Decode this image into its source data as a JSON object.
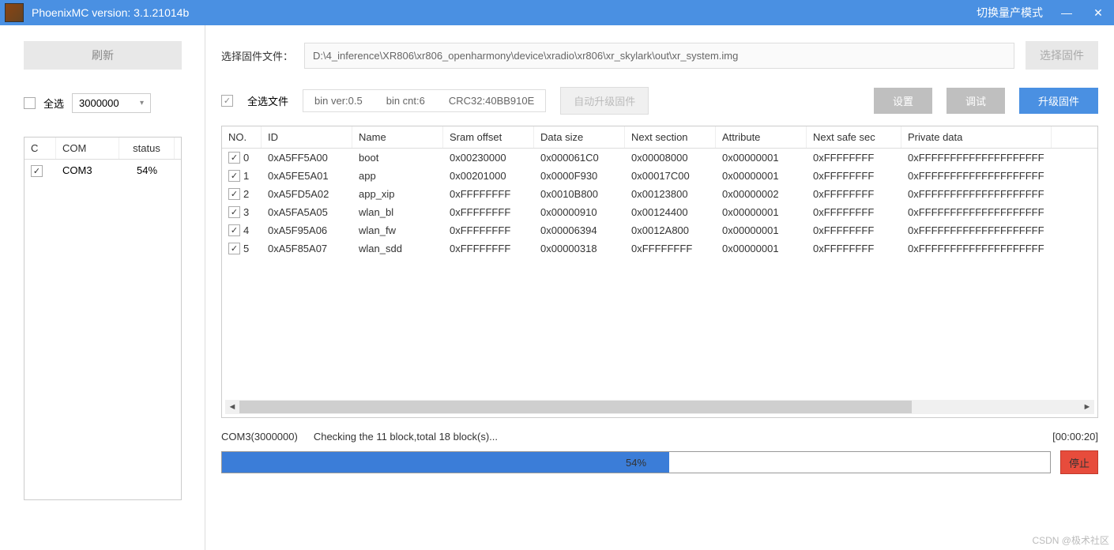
{
  "titlebar": {
    "title": "PhoenixMC version: 3.1.21014b",
    "mode_switch": "切换量产模式",
    "minimize": "—",
    "close": "✕"
  },
  "sidebar": {
    "refresh": "刷新",
    "select_all_label": "全选",
    "baud_select": "3000000",
    "columns": {
      "c": "C",
      "com": "COM",
      "status": "status"
    },
    "rows": [
      {
        "checked": true,
        "com": "COM3",
        "status": "54%"
      }
    ]
  },
  "firmware": {
    "label": "选择固件文件：",
    "path": "D:\\4_inference\\XR806\\xr806_openharmony\\device\\xradio\\xr806\\xr_skylark\\out\\xr_system.img",
    "select_btn": "选择固件"
  },
  "info": {
    "select_all_files": "全选文件",
    "bin_ver": "bin ver:0.5",
    "bin_cnt": "bin cnt:6",
    "crc": "CRC32:40BB910E",
    "auto_upgrade": "自动升级固件",
    "settings": "设置",
    "debug": "调试",
    "upgrade": "升级固件"
  },
  "grid": {
    "headers": {
      "no": "NO.",
      "id": "ID",
      "name": "Name",
      "sram": "Sram offset",
      "size": "Data size",
      "next": "Next section",
      "attr": "Attribute",
      "safe": "Next safe sec",
      "priv": "Private data"
    },
    "rows": [
      {
        "no": "0",
        "id": "0xA5FF5A00",
        "name": "boot",
        "sram": "0x00230000",
        "size": "0x000061C0",
        "next": "0x00008000",
        "attr": "0x00000001",
        "safe": "0xFFFFFFFF",
        "priv": "0xFFFFFFFFFFFFFFFFFFFF"
      },
      {
        "no": "1",
        "id": "0xA5FE5A01",
        "name": "app",
        "sram": "0x00201000",
        "size": "0x0000F930",
        "next": "0x00017C00",
        "attr": "0x00000001",
        "safe": "0xFFFFFFFF",
        "priv": "0xFFFFFFFFFFFFFFFFFFFF"
      },
      {
        "no": "2",
        "id": "0xA5FD5A02",
        "name": "app_xip",
        "sram": "0xFFFFFFFF",
        "size": "0x0010B800",
        "next": "0x00123800",
        "attr": "0x00000002",
        "safe": "0xFFFFFFFF",
        "priv": "0xFFFFFFFFFFFFFFFFFFFF"
      },
      {
        "no": "3",
        "id": "0xA5FA5A05",
        "name": "wlan_bl",
        "sram": "0xFFFFFFFF",
        "size": "0x00000910",
        "next": "0x00124400",
        "attr": "0x00000001",
        "safe": "0xFFFFFFFF",
        "priv": "0xFFFFFFFFFFFFFFFFFFFF"
      },
      {
        "no": "4",
        "id": "0xA5F95A06",
        "name": "wlan_fw",
        "sram": "0xFFFFFFFF",
        "size": "0x00006394",
        "next": "0x0012A800",
        "attr": "0x00000001",
        "safe": "0xFFFFFFFF",
        "priv": "0xFFFFFFFFFFFFFFFFFFFF"
      },
      {
        "no": "5",
        "id": "0xA5F85A07",
        "name": "wlan_sdd",
        "sram": "0xFFFFFFFF",
        "size": "0x00000318",
        "next": "0xFFFFFFFF",
        "attr": "0x00000001",
        "safe": "0xFFFFFFFF",
        "priv": "0xFFFFFFFFFFFFFFFFFFFF"
      }
    ]
  },
  "status": {
    "port": "COM3(3000000)",
    "text": "Checking the 11 block,total 18 block(s)...",
    "timer": "[00:00:20]"
  },
  "progress": {
    "percent": 54,
    "label": "54%",
    "stop": "停止"
  },
  "watermark": "CSDN @极术社区"
}
